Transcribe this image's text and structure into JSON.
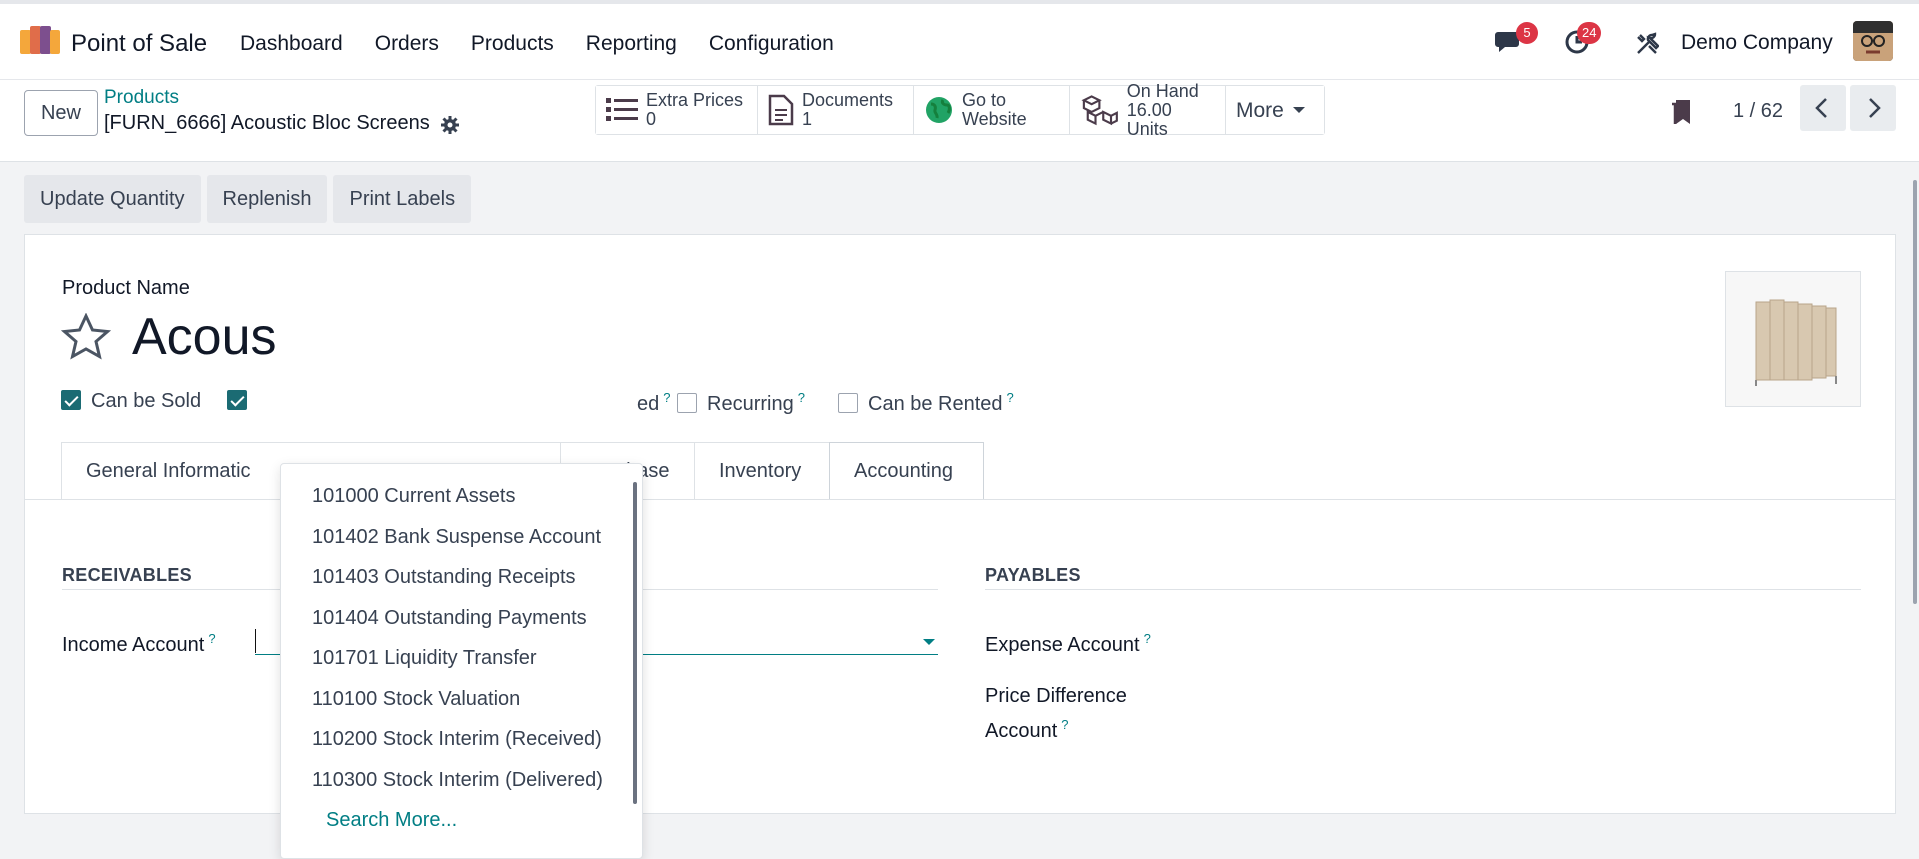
{
  "topbar": {
    "app_name": "Point of Sale",
    "menu": [
      "Dashboard",
      "Orders",
      "Products",
      "Reporting",
      "Configuration"
    ],
    "messages_badge": "5",
    "activities_badge": "24",
    "company": "Demo Company"
  },
  "controlbar": {
    "new_label": "New",
    "breadcrumb": "Products",
    "record_name": "[FURN_6666] Acoustic Bloc Screens",
    "smart_buttons": [
      {
        "line1": "Extra Prices",
        "line2": "0"
      },
      {
        "line1": "Documents",
        "line2": "1"
      },
      {
        "line1": "Go to",
        "line2": "Website"
      },
      {
        "line1": "On Hand",
        "line2": "16.00 Units"
      }
    ],
    "more_label": "More",
    "pager": "1 / 62"
  },
  "actions": [
    "Update Quantity",
    "Replenish",
    "Print Labels"
  ],
  "form": {
    "product_name_label": "Product Name",
    "product_name_visible": "Acous",
    "checks": [
      {
        "label": "Can be Sold",
        "checked": true
      },
      {
        "label": "ed",
        "checked": true
      },
      {
        "label": "Recurring",
        "checked": false
      },
      {
        "label": "Can be Rented",
        "checked": false
      }
    ],
    "tabs": [
      "General Informatic",
      "Purchase",
      "Inventory",
      "Accounting"
    ],
    "active_tab": "Accounting",
    "receivables_title": "RECEIVABLES",
    "payables_title": "PAYABLES",
    "income_account_label": "Income Account",
    "expense_account_label": "Expense Account",
    "price_diff_label_1": "Price Difference",
    "price_diff_label_2": "Account",
    "help_mark": "?"
  },
  "dropdown": {
    "items": [
      "101000 Current Assets",
      "101402 Bank Suspense Account",
      "101403 Outstanding Receipts",
      "101404 Outstanding Payments",
      "101701 Liquidity Transfer",
      "110100 Stock Valuation",
      "110200 Stock Interim (Received)",
      "110300 Stock Interim (Delivered)"
    ],
    "search_more": "Search More..."
  },
  "colors": {
    "accent": "#017e84",
    "badge": "#dc3545",
    "checkbox": "#1b6b73"
  }
}
